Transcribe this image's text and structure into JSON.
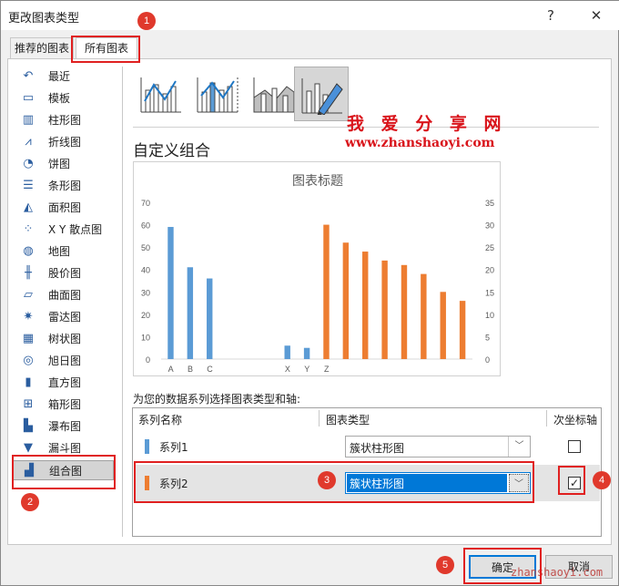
{
  "window": {
    "title": "更改图表类型",
    "help": "?",
    "close": "✕"
  },
  "tabs": [
    {
      "label": "推荐的图表"
    },
    {
      "label": "所有图表"
    }
  ],
  "sidebar": {
    "items": [
      {
        "label": "最近",
        "icon": "recent-icon",
        "glyph": "↶"
      },
      {
        "label": "模板",
        "icon": "folder-icon",
        "glyph": "▭"
      },
      {
        "label": "柱形图",
        "icon": "column-chart-icon",
        "glyph": "▥"
      },
      {
        "label": "折线图",
        "icon": "line-chart-icon",
        "glyph": "⩘"
      },
      {
        "label": "饼图",
        "icon": "pie-chart-icon",
        "glyph": "◔"
      },
      {
        "label": "条形图",
        "icon": "bar-chart-icon",
        "glyph": "☰"
      },
      {
        "label": "面积图",
        "icon": "area-chart-icon",
        "glyph": "◭"
      },
      {
        "label": "X Y 散点图",
        "icon": "scatter-chart-icon",
        "glyph": "⁘"
      },
      {
        "label": "地图",
        "icon": "map-icon",
        "glyph": "◍"
      },
      {
        "label": "股价图",
        "icon": "stock-chart-icon",
        "glyph": "╫"
      },
      {
        "label": "曲面图",
        "icon": "surface-chart-icon",
        "glyph": "▱"
      },
      {
        "label": "雷达图",
        "icon": "radar-chart-icon",
        "glyph": "✷"
      },
      {
        "label": "树状图",
        "icon": "treemap-icon",
        "glyph": "▦"
      },
      {
        "label": "旭日图",
        "icon": "sunburst-icon",
        "glyph": "◎"
      },
      {
        "label": "直方图",
        "icon": "histogram-icon",
        "glyph": "▮"
      },
      {
        "label": "箱形图",
        "icon": "box-whisker-icon",
        "glyph": "⊞"
      },
      {
        "label": "瀑布图",
        "icon": "waterfall-icon",
        "glyph": "▙"
      },
      {
        "label": "漏斗图",
        "icon": "funnel-icon",
        "glyph": "▼"
      },
      {
        "label": "组合图",
        "icon": "combo-chart-icon",
        "glyph": "▟"
      }
    ]
  },
  "combo_types": [
    {
      "name": "clustered-column-line"
    },
    {
      "name": "clustered-column-line-secondary"
    },
    {
      "name": "stacked-area-clustered-column"
    },
    {
      "name": "custom-combination"
    }
  ],
  "section_title": "自定义组合",
  "watermark": {
    "cn": "我 爱 分 享 网",
    "url": "www.zhanshaoyi.com",
    "bottom": "zhanshaoyi.com"
  },
  "chart_data": {
    "type": "bar",
    "title": "图表标题",
    "categories": [
      "A",
      "B",
      "C",
      "",
      "",
      "",
      "X",
      "Y",
      "Z",
      "",
      "",
      "",
      "",
      "",
      "",
      ""
    ],
    "series": [
      {
        "name": "系列1",
        "axis": "primary",
        "color": "#5b9bd5",
        "values": [
          59,
          41,
          36,
          null,
          null,
          null,
          6,
          5,
          null,
          null,
          null,
          null,
          null,
          null,
          null,
          null
        ]
      },
      {
        "name": "系列2",
        "axis": "secondary",
        "color": "#ed7d31",
        "values": [
          null,
          null,
          null,
          null,
          null,
          null,
          null,
          null,
          30,
          26,
          24,
          22,
          21,
          19,
          15,
          13
        ]
      }
    ],
    "ylim": [
      0,
      70
    ],
    "y2lim": [
      0,
      35
    ],
    "yticks": [
      "0",
      "10",
      "20",
      "30",
      "40",
      "50",
      "60",
      "70"
    ],
    "y2ticks": [
      "0",
      "5",
      "10",
      "15",
      "20",
      "25",
      "30",
      "35"
    ]
  },
  "series_prompt": "为您的数据系列选择图表类型和轴:",
  "table": {
    "headers": {
      "name": "系列名称",
      "type": "图表类型",
      "axis": "次坐标轴"
    },
    "rows": [
      {
        "name": "系列1",
        "type": "簇状柱形图",
        "secondary": false,
        "color": "#5b9bd5"
      },
      {
        "name": "系列2",
        "type": "簇状柱形图",
        "secondary": true,
        "color": "#ed7d31"
      }
    ]
  },
  "buttons": {
    "ok": "确定",
    "cancel": "取消"
  },
  "badges": [
    "1",
    "2",
    "3",
    "4",
    "5"
  ],
  "colors": {
    "highlight": "#e02020",
    "accent": "#0078d7"
  }
}
